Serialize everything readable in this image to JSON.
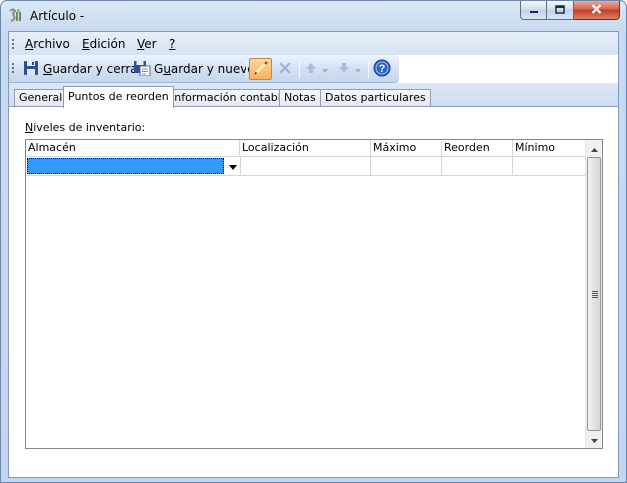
{
  "window": {
    "title": "Artículo -",
    "icon": "app-logo-icon",
    "controls": [
      "minimize-icon",
      "maximize-icon",
      "close-icon"
    ]
  },
  "menubar": {
    "items": [
      {
        "accel": "A",
        "rest": "rchivo"
      },
      {
        "accel": "E",
        "rest": "dición"
      },
      {
        "accel": "V",
        "rest": "er"
      },
      {
        "accel": "?",
        "rest": ""
      }
    ]
  },
  "toolbar": {
    "save_close": {
      "accel": "G",
      "rest": "uardar y cerrar"
    },
    "save_new": {
      "before": "G",
      "accel": "u",
      "rest": "ardar y nuevo"
    },
    "icons": [
      "save-icon",
      "save-new-icon",
      "edit-icon",
      "delete-icon",
      "move-up-icon",
      "move-down-icon",
      "help-icon"
    ]
  },
  "tabs": [
    "General",
    "Puntos de reorden",
    "Información contable",
    "Notas",
    "Datos particulares"
  ],
  "active_tab": "Puntos de reorden",
  "inventory": {
    "label_accel": "N",
    "label_rest": "iveles de inventario:",
    "columns": [
      "Almacén",
      "Localización",
      "Máximo",
      "Reorden",
      "Mínimo"
    ],
    "rows": [
      {
        "almacen": "",
        "localizacion": "",
        "maximo": "",
        "reorden": "",
        "minimo": ""
      }
    ]
  },
  "colors": {
    "selection": "#3399ff",
    "titlebar": "#c9dbf1",
    "close_button": "#c43c26"
  }
}
